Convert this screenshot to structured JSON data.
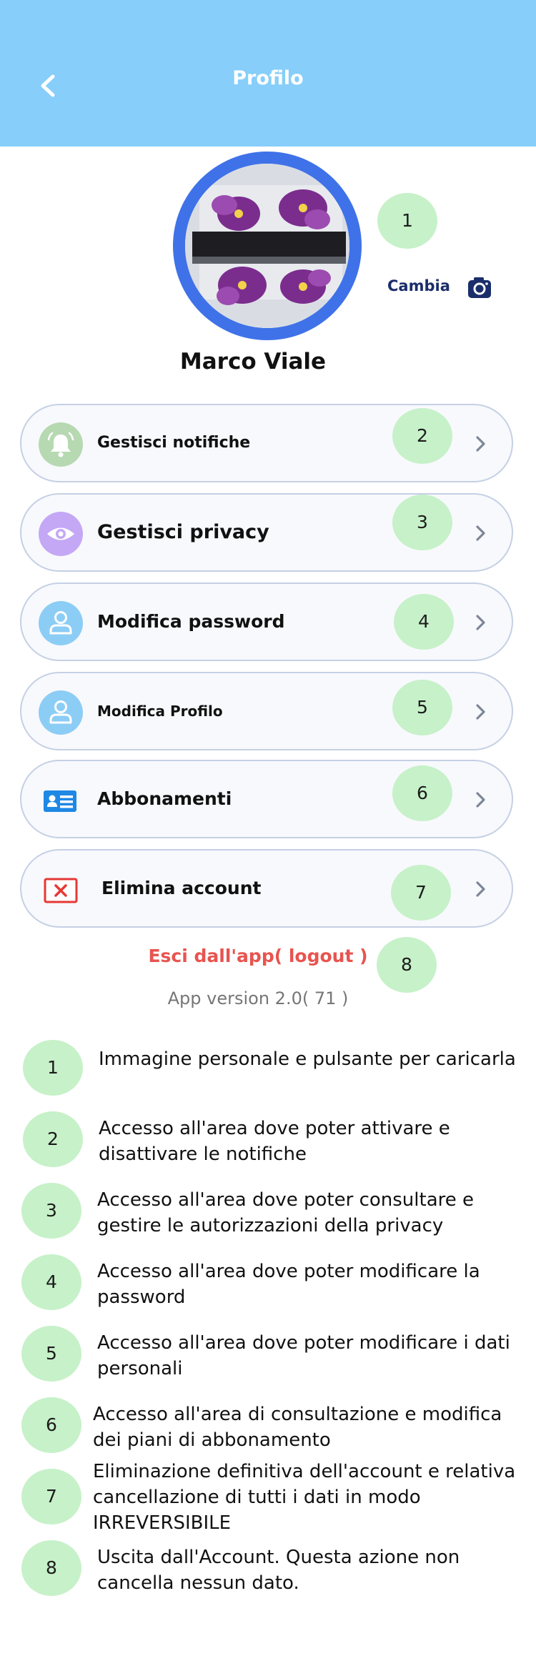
{
  "header": {
    "title": "Profilo"
  },
  "profile": {
    "change_label": "Cambia",
    "name": "Marco Viale"
  },
  "menu": [
    {
      "label": "Gestisci notifiche",
      "badge": "2"
    },
    {
      "label": "Gestisci privacy",
      "badge": "3"
    },
    {
      "label": "Modifica password",
      "badge": "4"
    },
    {
      "label": "Modifica Profilo",
      "badge": "5"
    },
    {
      "label": "Abbonamenti",
      "badge": "6"
    },
    {
      "label": "Elimina account",
      "badge": "7"
    }
  ],
  "badges": {
    "avatar": "1",
    "logout": "8"
  },
  "footer": {
    "logout": "Esci dall'app( logout )",
    "version": "App version 2.0( 71 )"
  },
  "legend": [
    {
      "num": "1",
      "text": "Immagine personale e pulsante per caricarla"
    },
    {
      "num": "2",
      "text": "Accesso all'area dove poter attivare e disattivare le notifiche"
    },
    {
      "num": "3",
      "text": "Accesso all'area dove poter consultare e gestire le autorizzazioni della privacy"
    },
    {
      "num": "4",
      "text": "Accesso all'area dove poter modificare la password"
    },
    {
      "num": "5",
      "text": "Accesso all'area dove poter modificare i dati personali"
    },
    {
      "num": "6",
      "text": "Accesso all'area di consultazione e modifica dei piani di abbonamento"
    },
    {
      "num": "7",
      "text": "Eliminazione definitiva dell'account e relativa cancellazione di tutti i dati in modo IRREVERSIBILE"
    },
    {
      "num": "8",
      "text": "Uscita dall'Account. Questa azione non cancella nessun dato."
    }
  ]
}
